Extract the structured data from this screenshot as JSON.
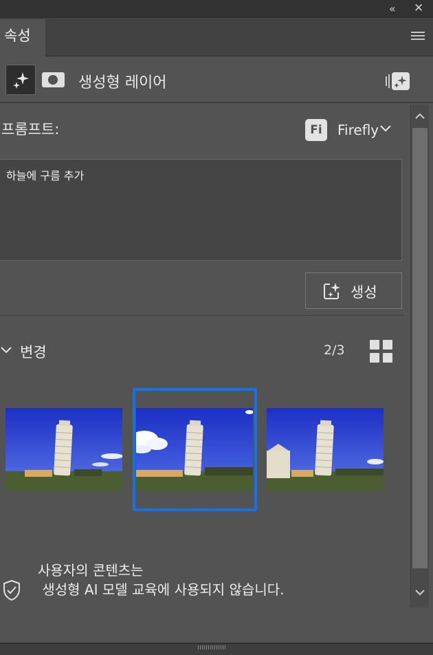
{
  "window": {
    "collapse_icon": "double-chevron-left-icon",
    "close_icon": "close-icon"
  },
  "tab": {
    "label": "속성",
    "menu_icon": "hamburger-menu-icon"
  },
  "layer": {
    "type_label": "생성형 레이어",
    "generative_icon": "sparkle-icon",
    "mask_icon": "mask-icon",
    "convert_icon": "generative-layer-icon"
  },
  "prompt": {
    "label": "프롬프트:",
    "model_badge": "Fi",
    "model": "Firefly",
    "value": "하늘에 구름 추가"
  },
  "generate": {
    "label": "생성",
    "icon": "generate-sparkle-icon"
  },
  "variations": {
    "label": "변경",
    "count": "2/3",
    "selected_index": 1,
    "thumbnails": [
      "pisa-variation-1",
      "pisa-variation-2",
      "pisa-variation-3"
    ]
  },
  "footer": {
    "line1": "사용자의 콘텐츠는",
    "line2": " 생성형 AI 모델 교육에 사용되지 않습니다."
  },
  "colors": {
    "panel": "#535353",
    "selection": "#1373e6",
    "sky": "#2c3fd0",
    "grass": "#4a5e2f"
  }
}
